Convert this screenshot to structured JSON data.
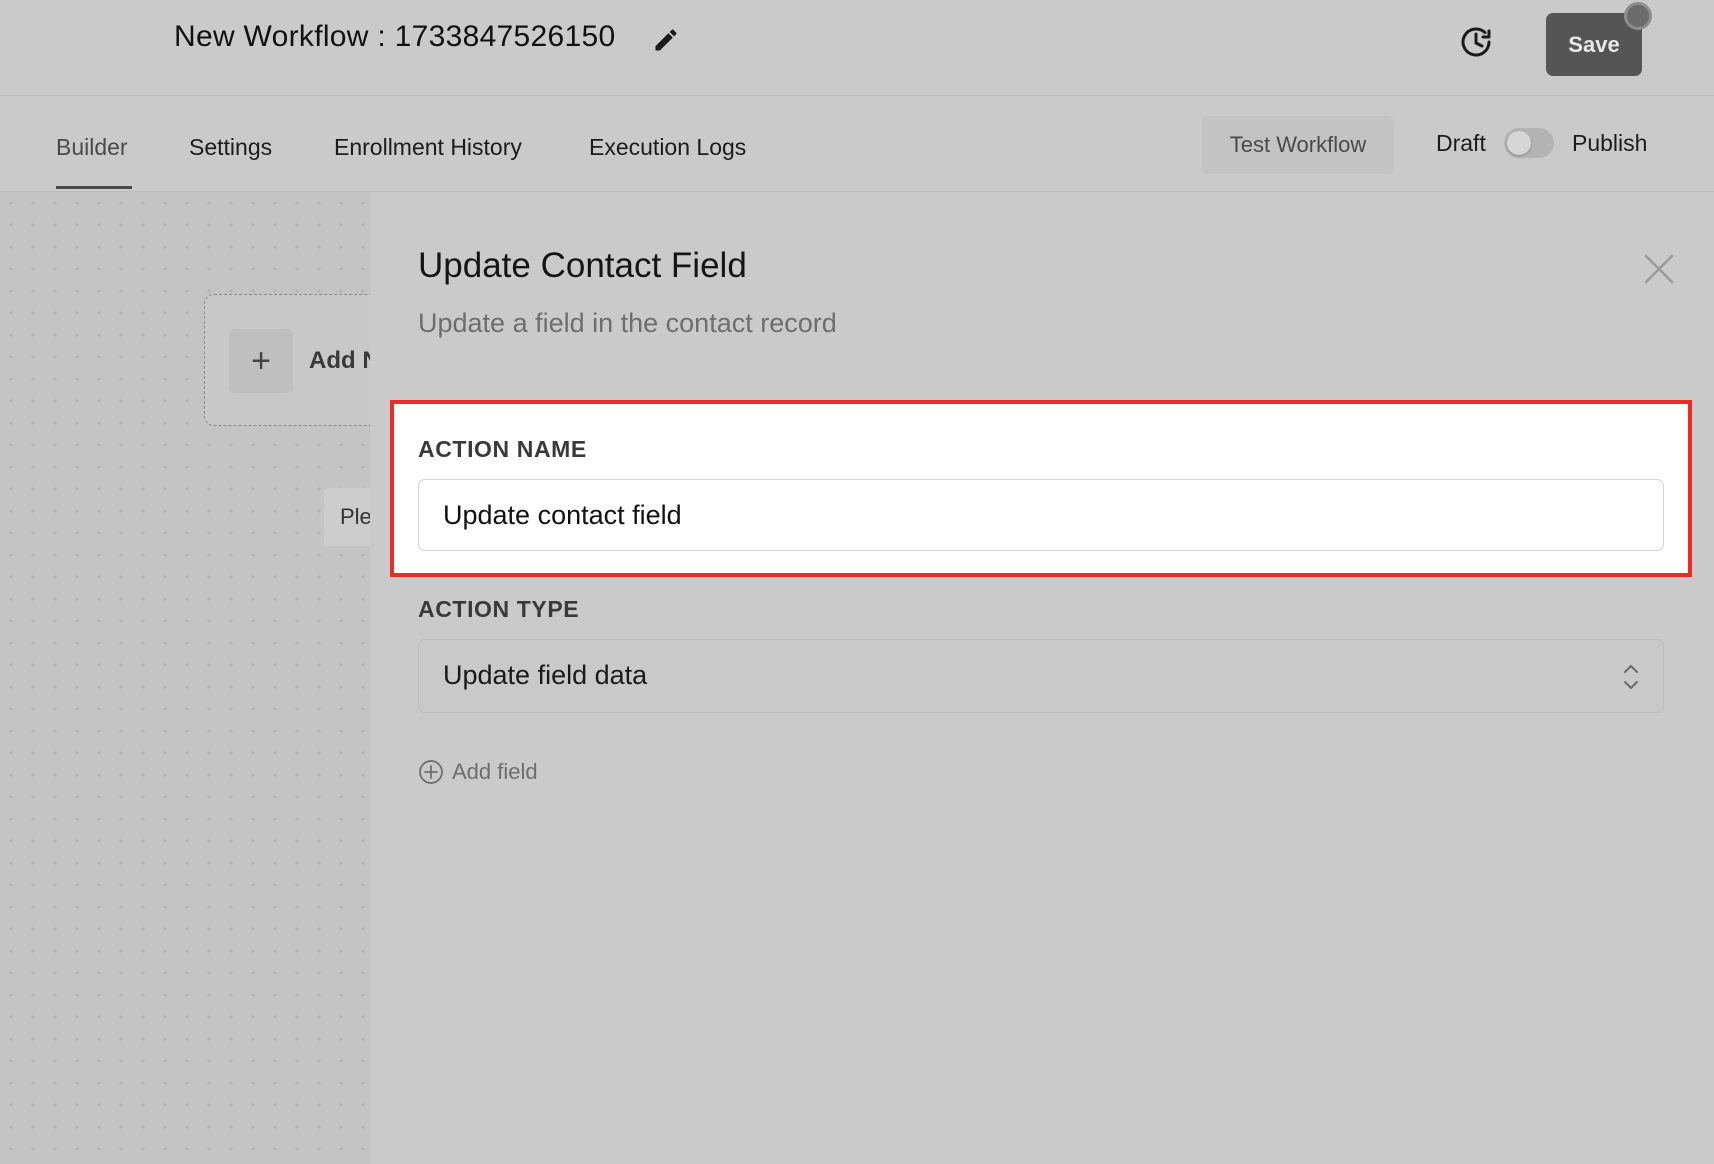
{
  "header": {
    "title": "New Workflow : 1733847526150",
    "save_label": "Save"
  },
  "tabs": [
    {
      "label": "Builder",
      "active": true
    },
    {
      "label": "Settings",
      "active": false
    },
    {
      "label": "Enrollment History",
      "active": false
    },
    {
      "label": "Execution Logs",
      "active": false
    }
  ],
  "toolbar": {
    "test_label": "Test Workflow",
    "draft_label": "Draft",
    "publish_label": "Publish",
    "publish_enabled": false
  },
  "canvas": {
    "add_node_label": "Add N",
    "hint_label": "Ple"
  },
  "panel": {
    "title": "Update Contact Field",
    "subtitle": "Update a field in the contact record",
    "action_name_label": "ACTION NAME",
    "action_name_value": "Update contact field",
    "action_type_label": "ACTION TYPE",
    "action_type_value": "Update field data",
    "add_field_label": "Add field"
  },
  "colors": {
    "highlight": "#ee2b24",
    "save_button": "#555555",
    "background": "#cacaca"
  }
}
